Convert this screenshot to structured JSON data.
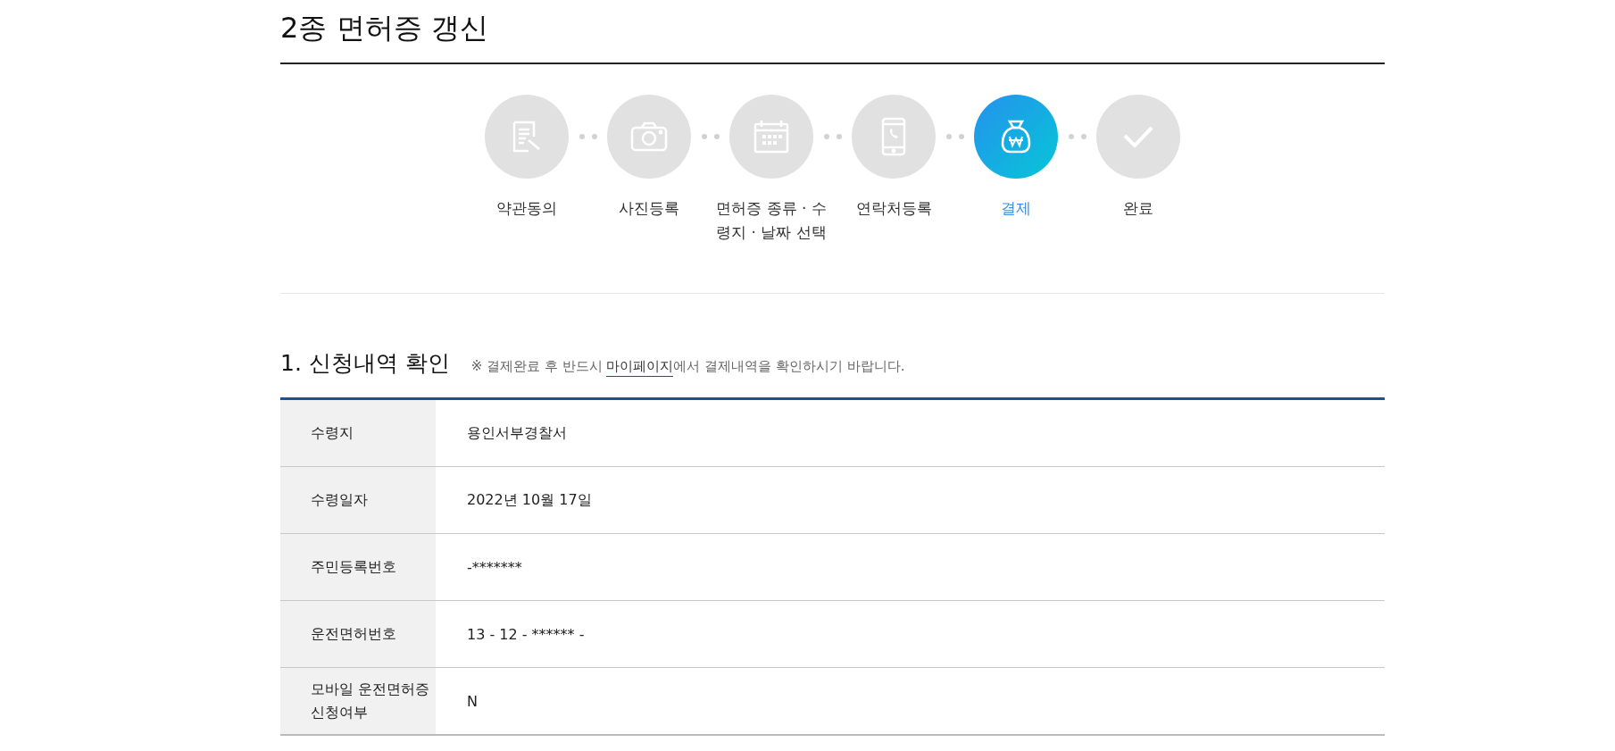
{
  "page_title": "2종 면허증 갱신",
  "steps": [
    {
      "label": "약관동의",
      "selected": false
    },
    {
      "label": "사진등록",
      "selected": false
    },
    {
      "label": "면허증 종류 · 수령지 · 날짜 선택",
      "selected": false
    },
    {
      "label": "연락처등록",
      "selected": false
    },
    {
      "label": "결제",
      "selected": true
    },
    {
      "label": "완료",
      "selected": false
    }
  ],
  "section": {
    "title": "1. 신청내역 확인",
    "note_before": "※ 결제완료 후 반드시 ",
    "note_link": "마이페이지",
    "note_after": "에서 결제내역을 확인하시기 바랍니다."
  },
  "rows": [
    {
      "label": "수령지",
      "value": "용인서부경찰서"
    },
    {
      "label": "수령일자",
      "value": "2022년 10월 17일"
    },
    {
      "label": "주민등록번호",
      "value": "-*******"
    },
    {
      "label": "운전면허번호",
      "value": "13 - 12 - ****** -"
    },
    {
      "label": "모바일 운전면허증 신청여부",
      "value": "N"
    }
  ]
}
